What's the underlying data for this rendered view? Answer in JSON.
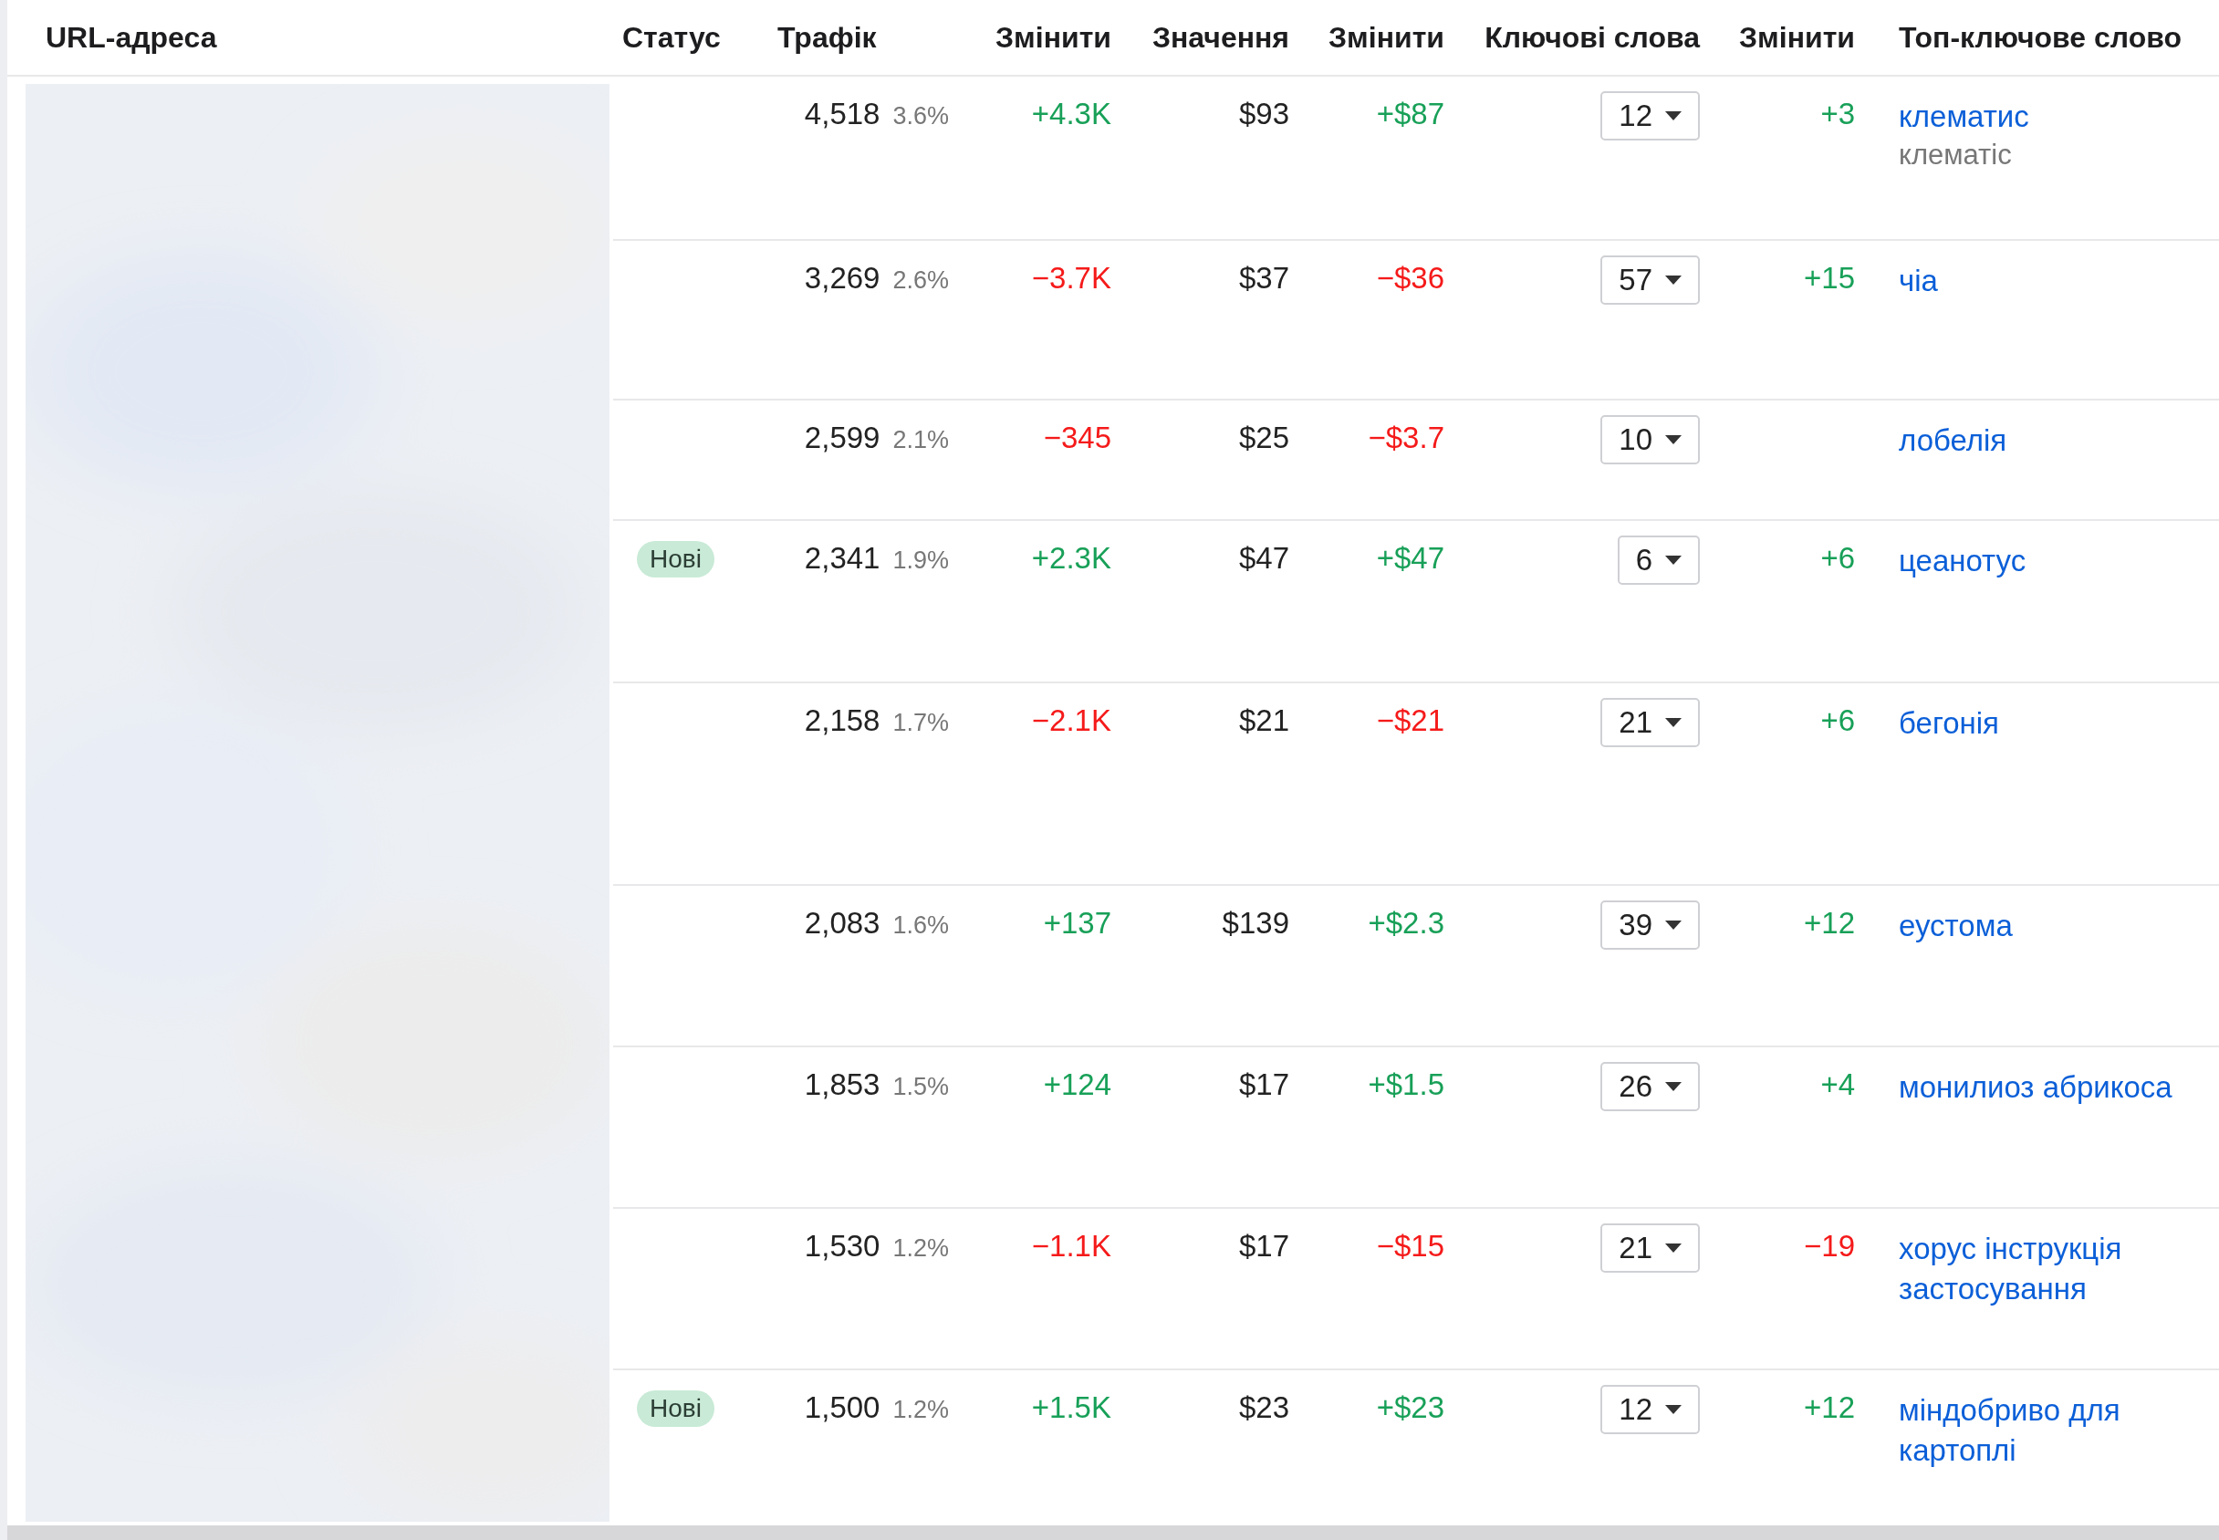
{
  "table": {
    "columns": [
      "URL-адреса",
      "Статус",
      "Трафік",
      "Змінити",
      "Значення",
      "Змінити",
      "Ключові слова",
      "Змінити",
      "Топ-ключове слово"
    ],
    "rows": [
      {
        "traffic": "4,518",
        "share": "3.6%",
        "change": {
          "text": "+4.3K",
          "color": "#18a058"
        },
        "value": "$93",
        "value_change": {
          "text": "+$87",
          "color": "#18a058"
        },
        "keywords": "12",
        "keywords_change": {
          "text": "+3",
          "color": "#18a058"
        },
        "top_keyword": "клематис",
        "top_keyword_note": "клематіс"
      },
      {
        "traffic": "3,269",
        "share": "2.6%",
        "change": {
          "text": "−3.7K",
          "color": "#f51a1a"
        },
        "value": "$37",
        "value_change": {
          "text": "−$36",
          "color": "#f51a1a"
        },
        "keywords": "57",
        "keywords_change": {
          "text": "+15",
          "color": "#18a058"
        },
        "top_keyword": "чіа"
      },
      {
        "traffic": "2,599",
        "share": "2.1%",
        "change": {
          "text": "−345",
          "color": "#f51a1a"
        },
        "value": "$25",
        "value_change": {
          "text": "−$3.7",
          "color": "#f51a1a"
        },
        "keywords": "10",
        "top_keyword": "лобелія"
      },
      {
        "status": "Нові",
        "traffic": "2,341",
        "share": "1.9%",
        "change": {
          "text": "+2.3K",
          "color": "#18a058"
        },
        "value": "$47",
        "value_change": {
          "text": "+$47",
          "color": "#18a058"
        },
        "keywords": "6",
        "keywords_change": {
          "text": "+6",
          "color": "#18a058"
        },
        "top_keyword": "цеанотус"
      },
      {
        "traffic": "2,158",
        "share": "1.7%",
        "change": {
          "text": "−2.1K",
          "color": "#f51a1a"
        },
        "value": "$21",
        "value_change": {
          "text": "−$21",
          "color": "#f51a1a"
        },
        "keywords": "21",
        "keywords_change": {
          "text": "+6",
          "color": "#18a058"
        },
        "top_keyword": "бегонія"
      },
      {
        "traffic": "2,083",
        "share": "1.6%",
        "change": {
          "text": "+137",
          "color": "#18a058"
        },
        "value": "$139",
        "value_change": {
          "text": "+$2.3",
          "color": "#18a058"
        },
        "keywords": "39",
        "keywords_change": {
          "text": "+12",
          "color": "#18a058"
        },
        "top_keyword": "еустома"
      },
      {
        "traffic": "1,853",
        "share": "1.5%",
        "change": {
          "text": "+124",
          "color": "#18a058"
        },
        "value": "$17",
        "value_change": {
          "text": "+$1.5",
          "color": "#18a058"
        },
        "keywords": "26",
        "keywords_change": {
          "text": "+4",
          "color": "#18a058"
        },
        "top_keyword": "монилиоз абрикоса"
      },
      {
        "traffic": "1,530",
        "share": "1.2%",
        "change": {
          "text": "−1.1K",
          "color": "#f51a1a"
        },
        "value": "$17",
        "value_change": {
          "text": "−$15",
          "color": "#f51a1a"
        },
        "keywords": "21",
        "keywords_change": {
          "text": "−19",
          "color": "#f51a1a"
        },
        "top_keyword": "хорус інструкція застосування"
      },
      {
        "status": "Нові",
        "traffic": "1,500",
        "share": "1.2%",
        "change": {
          "text": "+1.5K",
          "color": "#18a058"
        },
        "value": "$23",
        "value_change": {
          "text": "+$23",
          "color": "#18a058"
        },
        "keywords": "12",
        "keywords_change": {
          "text": "+12",
          "color": "#18a058"
        },
        "top_keyword": "міндобриво для картоплі"
      }
    ]
  }
}
